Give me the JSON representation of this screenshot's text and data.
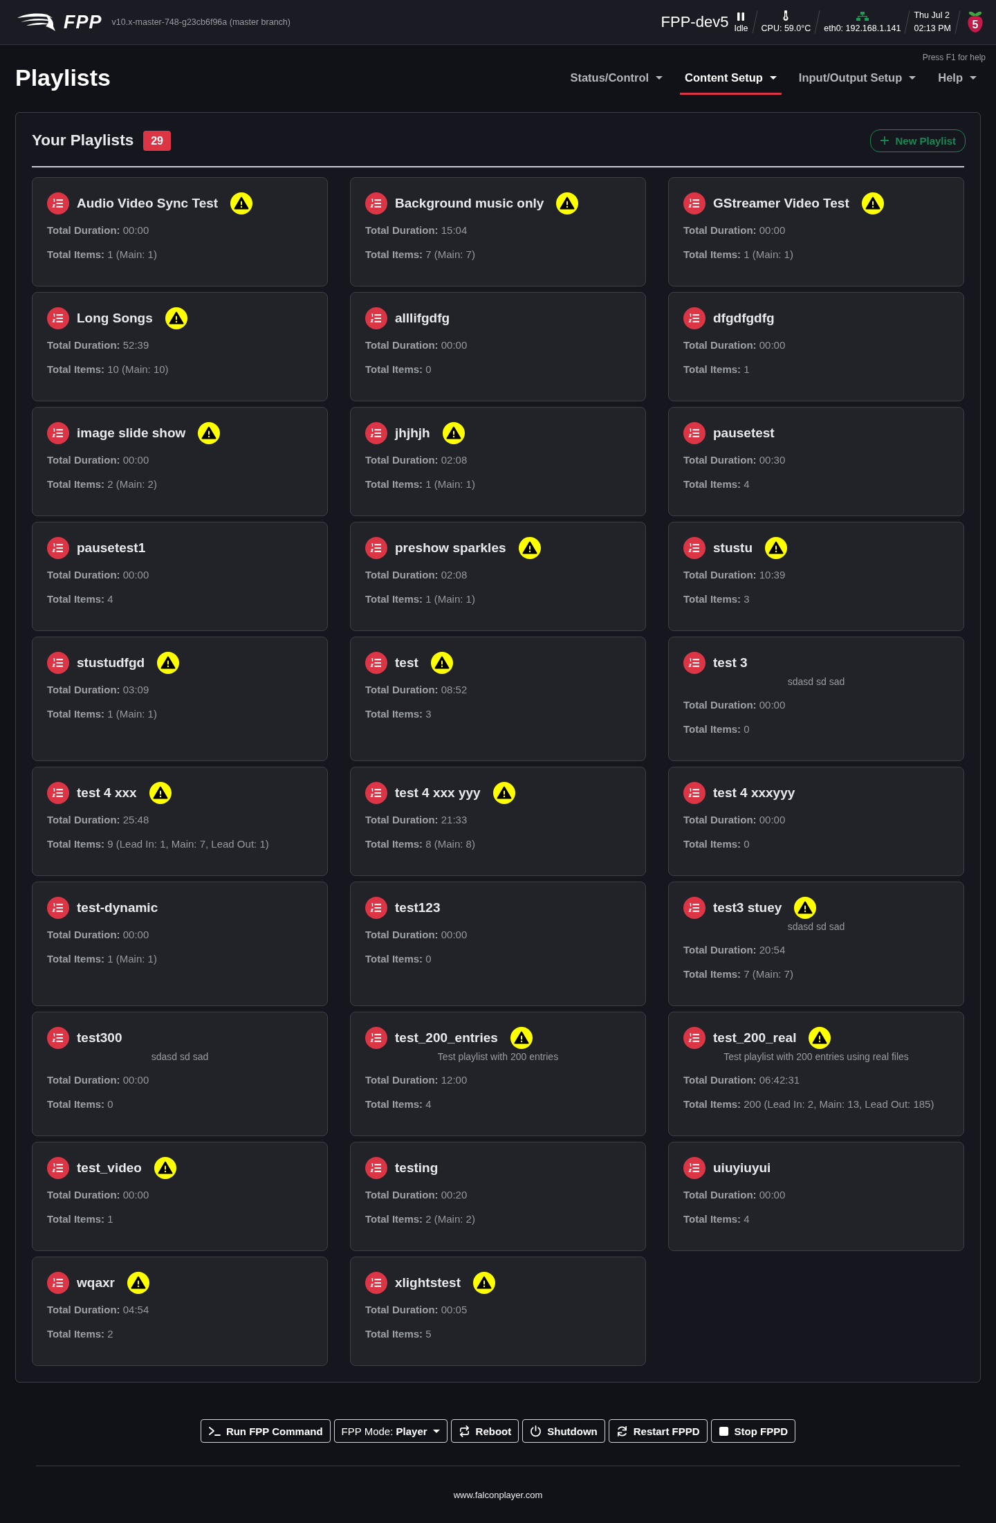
{
  "header": {
    "logo_text": "FPP",
    "version": "v10.x-master-748-g23cb6f96a (master branch)",
    "hostname": "FPP-dev5",
    "status": [
      {
        "kind": "player",
        "text": "Idle"
      },
      {
        "kind": "cpu",
        "text": "CPU: 59.0°C"
      },
      {
        "kind": "network",
        "text": "eth0: 192.168.1.141"
      }
    ],
    "date": "Thu Jul 2",
    "time": "02:13 PM",
    "board": "5"
  },
  "help_hint": "Press F1 for help",
  "page_title": "Playlists",
  "nav": [
    {
      "label": "Status/Control",
      "selected": false
    },
    {
      "label": "Content Setup",
      "selected": true
    },
    {
      "label": "Input/Output Setup",
      "selected": false
    },
    {
      "label": "Help",
      "selected": false
    }
  ],
  "panel": {
    "title": "Your Playlists",
    "count": "29",
    "new_button": "New Playlist",
    "playlists": [
      {
        "name": "Audio Video Sync Test",
        "warning": true,
        "duration": "**Total Duration:** 00:00",
        "items": "**Total Items:** 1 (Main: 1)"
      },
      {
        "name": "Background music only",
        "warning": true,
        "duration": "**Total Duration:** 15:04",
        "items": "**Total Items:** 7 (Main: 7)"
      },
      {
        "name": "GStreamer Video Test",
        "warning": true,
        "duration": "**Total Duration:** 00:00",
        "items": "**Total Items:** 1 (Main: 1)"
      },
      {
        "name": "Long Songs",
        "warning": true,
        "duration": "**Total Duration:** 52:39",
        "items": "**Total Items:** 10 (Main: 10)"
      },
      {
        "name": "alllifgdfg",
        "warning": false,
        "duration": "**Total Duration:** 00:00",
        "items": "**Total Items:** 0"
      },
      {
        "name": "dfgdfgdfg",
        "warning": false,
        "duration": "**Total Duration:** 00:00",
        "items": "**Total Items:** 1"
      },
      {
        "name": "image slide show",
        "warning": true,
        "duration": "**Total Duration:** 00:00",
        "items": "**Total Items:** 2 (Main: 2)"
      },
      {
        "name": "jhjhjh",
        "warning": true,
        "duration": "**Total Duration:** 02:08",
        "items": "**Total Items:** 1 (Main: 1)"
      },
      {
        "name": "pausetest",
        "warning": false,
        "duration": "**Total Duration:** 00:30",
        "items": "**Total Items:** 4"
      },
      {
        "name": "pausetest1",
        "warning": false,
        "duration": "**Total Duration:** 00:00",
        "items": "**Total Items:** 4"
      },
      {
        "name": "preshow sparkles",
        "warning": true,
        "duration": "**Total Duration:** 02:08",
        "items": "**Total Items:** 1 (Main: 1)"
      },
      {
        "name": "stustu",
        "warning": true,
        "duration": "**Total Duration:** 10:39",
        "items": "**Total Items:** 3"
      },
      {
        "name": "stustudfgd",
        "warning": true,
        "duration": "**Total Duration:** 03:09",
        "items": "**Total Items:** 1 (Main: 1)"
      },
      {
        "name": "test",
        "warning": true,
        "duration": "**Total Duration:** 08:52",
        "items": "**Total Items:** 3"
      },
      {
        "name": "test 3",
        "warning": false,
        "description": "sdasd sd sad",
        "duration": "**Total Duration:** 00:00",
        "items": "**Total Items:** 0"
      },
      {
        "name": "test 4 xxx",
        "warning": true,
        "duration": "**Total Duration:** 25:48",
        "items": "**Total Items:** 9 (Lead In: 1, Main: 7, Lead Out: 1)"
      },
      {
        "name": "test 4 xxx yyy",
        "warning": true,
        "duration": "**Total Duration:** 21:33",
        "items": "**Total Items:** 8 (Main: 8)"
      },
      {
        "name": "test 4 xxxyyy",
        "warning": false,
        "duration": "**Total Duration:** 00:00",
        "items": "**Total Items:** 0"
      },
      {
        "name": "test-dynamic",
        "warning": false,
        "duration": "**Total Duration:** 00:00",
        "items": "**Total Items:** 1 (Main: 1)"
      },
      {
        "name": "test123",
        "warning": false,
        "duration": "**Total Duration:** 00:00",
        "items": "**Total Items:** 0"
      },
      {
        "name": "test3 stuey",
        "warning": true,
        "description": "sdasd sd sad",
        "duration": "**Total Duration:** 20:54",
        "items": "**Total Items:** 7 (Main: 7)"
      },
      {
        "name": "test300",
        "warning": false,
        "description": "sdasd sd sad",
        "duration": "**Total Duration:** 00:00",
        "items": "**Total Items:** 0"
      },
      {
        "name": "test_200_entries",
        "warning": true,
        "description": "Test playlist with 200 entries",
        "duration": "**Total Duration:** 12:00",
        "items": "**Total Items:** 4"
      },
      {
        "name": "test_200_real",
        "warning": true,
        "description": "Test playlist with 200 entries using real files",
        "duration": "**Total Duration:** 06:42:31",
        "items": "**Total Items:** 200 (Lead In: 2, Main: 13, Lead Out: 185)"
      },
      {
        "name": "test_video",
        "warning": true,
        "duration": "**Total Duration:** 00:00",
        "items": "**Total Items:** 1"
      },
      {
        "name": "testing",
        "warning": false,
        "duration": "**Total Duration:** 00:20",
        "items": "**Total Items:** 2 (Main: 2)"
      },
      {
        "name": "uiuyiuyui",
        "warning": false,
        "duration": "**Total Duration:** 00:00",
        "items": "**Total Items:** 4"
      },
      {
        "name": "wqaxr",
        "warning": true,
        "duration": "**Total Duration:** 04:54",
        "items": "**Total Items:** 2"
      },
      {
        "name": "xlightstest",
        "warning": true,
        "duration": "**Total Duration:** 00:05",
        "items": "**Total Items:** 5"
      }
    ]
  },
  "footer": {
    "buttons": [
      {
        "kind": "command",
        "label": "Run FPP Command"
      },
      {
        "kind": "mode",
        "label": "FPP Mode: **Player**"
      },
      {
        "kind": "reboot",
        "label": "Reboot"
      },
      {
        "kind": "shutdown",
        "label": "Shutdown"
      },
      {
        "kind": "restart",
        "label": "Restart FPPD"
      },
      {
        "kind": "stop",
        "label": "Stop FPPD"
      }
    ],
    "link": "www.falconplayer.com"
  }
}
